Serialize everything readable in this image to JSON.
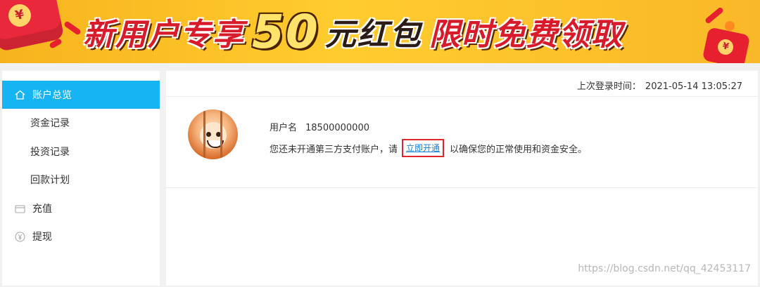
{
  "banner": {
    "text_part1": "新用户专享",
    "text_amount": "50",
    "text_part2": "元红包",
    "text_part3": "限时免费领取",
    "yen_symbol": "¥",
    "colors": {
      "background": "#ffc32a",
      "red": "#d81b2a"
    }
  },
  "sidebar": {
    "items": [
      {
        "label": "账户总览",
        "icon": "home-icon",
        "active": true
      },
      {
        "label": "资金记录",
        "sub": true
      },
      {
        "label": "投资记录",
        "sub": true
      },
      {
        "label": "回款计划",
        "sub": true
      },
      {
        "label": "充值",
        "icon": "wallet-icon"
      },
      {
        "label": "提现",
        "icon": "yen-circle-icon"
      }
    ],
    "active_color": "#17b4f3"
  },
  "main": {
    "last_login_label": "上次登录时间：",
    "last_login_time": "2021-05-14 13:05:27",
    "username_label": "用户名",
    "username_value": "18500000000",
    "notice_before": "您还未开通第三方支付账户，请",
    "open_link": "立即开通",
    "notice_after": "以确保您的正常使用和资金安全。"
  },
  "watermark": "https://blog.csdn.net/qq_42453117"
}
